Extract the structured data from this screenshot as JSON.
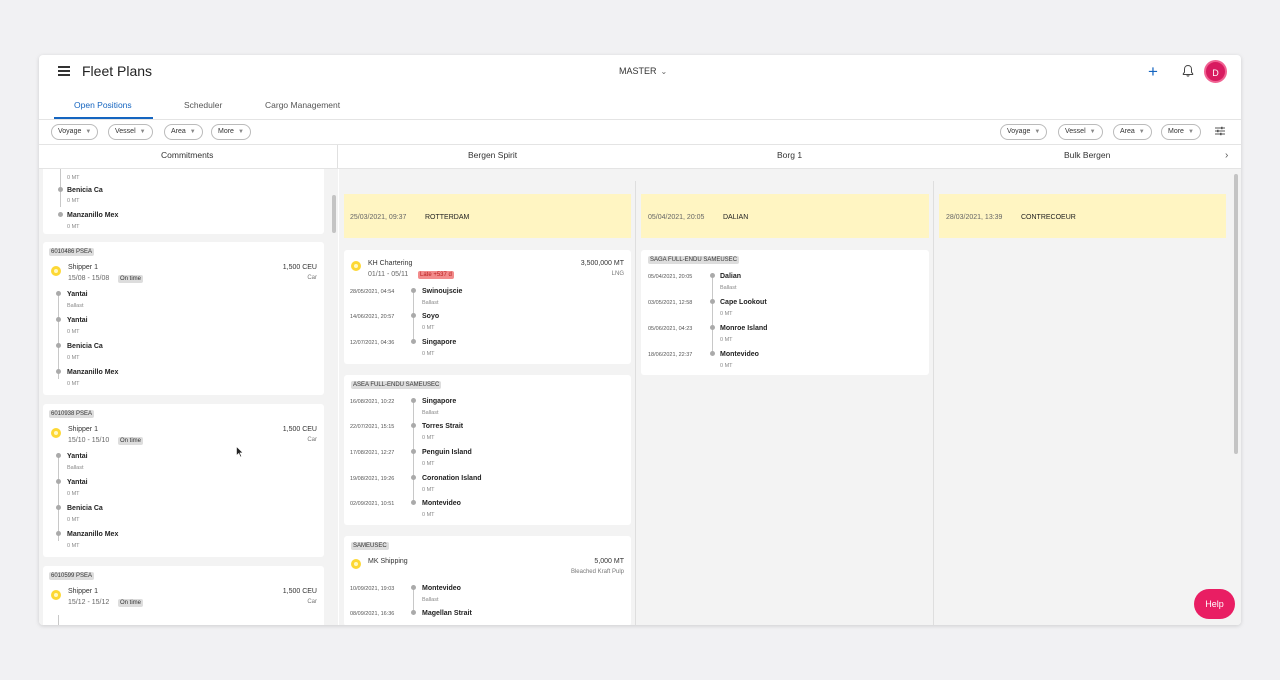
{
  "app": {
    "title": "Fleet Plans",
    "scenario": "MASTER",
    "avatar_initial": "D",
    "help_label": "Help"
  },
  "tabs": [
    "Open Positions",
    "Scheduler",
    "Cargo Management"
  ],
  "filters_left": [
    "Voyage",
    "Vessel",
    "Area",
    "More"
  ],
  "filters_right": [
    "Voyage",
    "Vessel",
    "Area",
    "More"
  ],
  "columns": {
    "commitments": "Commitments",
    "vessels": [
      "Bergen Spirit",
      "Borg 1",
      "Bulk Bergen"
    ]
  },
  "commitments": {
    "partial_top": {
      "items": [
        {
          "port": "",
          "qty": "0 MT"
        },
        {
          "port": "Benicia Ca",
          "qty": "0 MT"
        },
        {
          "port": "Manzanillo Mex",
          "qty": "0 MT"
        }
      ]
    },
    "cards": [
      {
        "id": "6010486 PSEA",
        "shipper": "Shipper 1",
        "dates": "15/08 - 15/08",
        "status": "On time",
        "quantity": "1,500 CEU",
        "cargo": "Car",
        "stops": [
          {
            "port": "Yantai",
            "sub": "Ballast"
          },
          {
            "port": "Yantai",
            "sub": "0 MT"
          },
          {
            "port": "Benicia Ca",
            "sub": "0 MT"
          },
          {
            "port": "Manzanillo Mex",
            "sub": "0 MT"
          }
        ]
      },
      {
        "id": "6010938 PSEA",
        "shipper": "Shipper 1",
        "dates": "15/10 - 15/10",
        "status": "On time",
        "quantity": "1,500 CEU",
        "cargo": "Car",
        "stops": [
          {
            "port": "Yantai",
            "sub": "Ballast"
          },
          {
            "port": "Yantai",
            "sub": "0 MT"
          },
          {
            "port": "Benicia Ca",
            "sub": "0 MT"
          },
          {
            "port": "Manzanillo Mex",
            "sub": "0 MT"
          }
        ]
      },
      {
        "id": "6010599 PSEA",
        "shipper": "Shipper 1",
        "dates": "15/12 - 15/12",
        "status": "On time",
        "quantity": "1,500 CEU",
        "cargo": "Car"
      }
    ]
  },
  "vessels": [
    {
      "banner": {
        "date": "25/03/2021, 09:37",
        "port": "ROTTERDAM"
      },
      "voyages": [
        {
          "charterer": "KH Chartering",
          "dates": "01/11 - 05/11",
          "late": "Late +537 d",
          "quantity": "3,500,000 MT",
          "cargo": "LNG",
          "stops": [
            {
              "date": "28/05/2021, 04:54",
              "port": "Swinoujscie",
              "sub": "Ballast"
            },
            {
              "date": "14/06/2021, 20:57",
              "port": "Soyo",
              "sub": "0 MT"
            },
            {
              "date": "12/07/2021, 04:36",
              "port": "Singapore",
              "sub": "0 MT"
            }
          ]
        },
        {
          "tag": "ASEA FULL-ENDU SAMEUSEC",
          "stops": [
            {
              "date": "16/08/2021, 10:22",
              "port": "Singapore",
              "sub": "Ballast"
            },
            {
              "date": "22/07/2021, 15:15",
              "port": "Torres Strait",
              "sub": "0 MT"
            },
            {
              "date": "17/08/2021, 12:27",
              "port": "Penguin Island",
              "sub": "0 MT"
            },
            {
              "date": "19/08/2021, 19:26",
              "port": "Coronation Island",
              "sub": "0 MT"
            },
            {
              "date": "02/09/2021, 10:51",
              "port": "Montevideo",
              "sub": "0 MT"
            }
          ]
        },
        {
          "tag": "SAMEUSEC",
          "charterer": "MK Shipping",
          "quantity": "5,000 MT",
          "cargo": "Bleached Kraft Pulp",
          "stops": [
            {
              "date": "10/09/2021, 19:03",
              "port": "Montevideo",
              "sub": "Ballast"
            },
            {
              "date": "08/09/2021, 16:36",
              "port": "Magellan Strait",
              "sub": ""
            }
          ]
        }
      ]
    },
    {
      "banner": {
        "date": "05/04/2021, 20:05",
        "port": "DALIAN"
      },
      "voyages": [
        {
          "tag": "SAGA FULL-ENDU SAMEUSEC",
          "stops": [
            {
              "date": "05/04/2021, 20:05",
              "port": "Dalian",
              "sub": "Ballast"
            },
            {
              "date": "03/05/2021, 12:58",
              "port": "Cape Lookout",
              "sub": "0 MT"
            },
            {
              "date": "05/06/2021, 04:23",
              "port": "Monroe Island",
              "sub": "0 MT"
            },
            {
              "date": "18/06/2021, 22:37",
              "port": "Montevideo",
              "sub": "0 MT"
            }
          ]
        }
      ]
    },
    {
      "banner": {
        "date": "28/03/2021, 13:39",
        "port": "CONTRECOEUR"
      },
      "voyages": []
    }
  ],
  "colors": {
    "accent": "#1565c0",
    "banner": "#fff5c2",
    "help": "#e91e63",
    "late": "#f28b8b",
    "star": "#fdd835"
  }
}
